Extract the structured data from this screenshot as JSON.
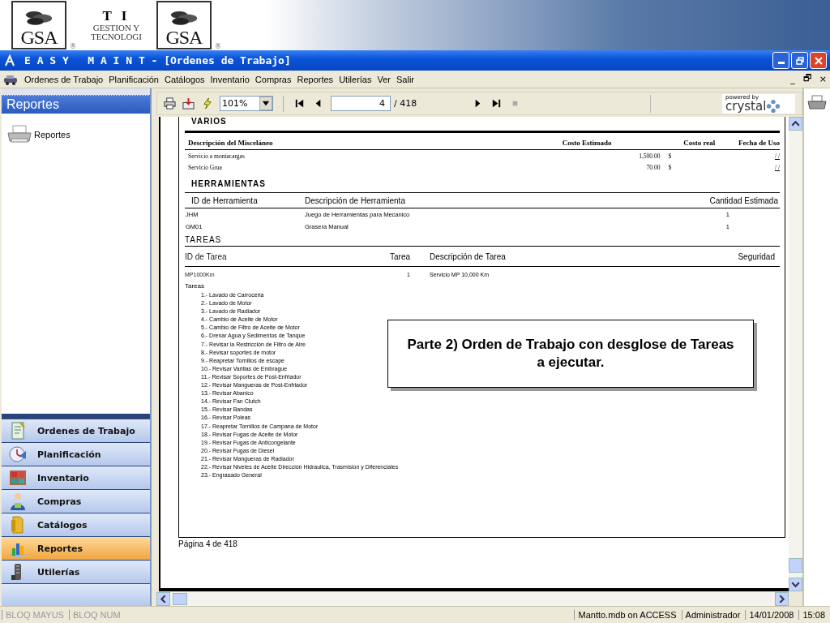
{
  "banner": {
    "logos": [
      {
        "text": "GSA",
        "mark": "®"
      },
      {
        "text": "GSA",
        "mark": "®"
      }
    ],
    "ti": "T I",
    "ti_lines": [
      "GESTION Y",
      "TECNOLOGI"
    ]
  },
  "window": {
    "title": "E A S Y   M A I N T - [Ordenes de Trabajo]"
  },
  "menu": {
    "items": [
      "Ordenes de Trabajo",
      "Planificación",
      "Catálogos",
      "Inventario",
      "Compras",
      "Reportes",
      "Utilerías",
      "Ver",
      "Salir"
    ],
    "mdi_controls": [
      "_",
      "🗗",
      "×"
    ]
  },
  "sidebar": {
    "title": "Reportes",
    "items": [
      {
        "label": "Reportes"
      }
    ],
    "nav": [
      {
        "label": "Ordenes de Trabajo",
        "kind": "document",
        "selected": false
      },
      {
        "label": "Planificación",
        "kind": "clock",
        "selected": false
      },
      {
        "label": "Inventario",
        "kind": "shelf",
        "selected": false
      },
      {
        "label": "Compras",
        "kind": "person",
        "selected": false
      },
      {
        "label": "Catálogos",
        "kind": "folder",
        "selected": false
      },
      {
        "label": "Reportes",
        "kind": "chart",
        "selected": true
      },
      {
        "label": "Utilerías",
        "kind": "tool",
        "selected": false
      }
    ]
  },
  "viewer": {
    "zoom": "101%",
    "page": "4",
    "page_total": "/ 418",
    "brand_small": "powered by",
    "brand": "crystal"
  },
  "report": {
    "varios": {
      "title": "VARIOS",
      "columns": [
        "Descripción del Misceláneo",
        "Costo Estimado",
        "Costo real",
        "Fecha de Uso"
      ],
      "rows": [
        {
          "description": "Servicio a montacargas",
          "cost": "1,500.00",
          "currency": "$",
          "date": "/   /"
        },
        {
          "description": "Servicio Grua",
          "cost": "70.00",
          "currency": "$",
          "date": "/   /"
        }
      ]
    },
    "herramientas": {
      "title": "HERRAMIENTAS",
      "columns": [
        "ID de Herramienta",
        "Descripción de Herramienta",
        "Cantidad Estimada"
      ],
      "rows": [
        {
          "id": "JHM",
          "description": "Juego de Herramientas para Mecanico",
          "qty": "1"
        },
        {
          "id": "GM01",
          "description": "Grasera Manual",
          "qty": "1"
        }
      ]
    },
    "tareas": {
      "title": "TAREAS",
      "columns": [
        "ID de Tarea",
        "Tarea",
        "Descripción de Tarea",
        "Seguridad"
      ],
      "rows": [
        {
          "id": "MP1000Km",
          "task": "1",
          "description": "Servicio MP 10,000 Km"
        }
      ]
    },
    "tasks_label": "Tareas",
    "tasks": [
      "1.- Lavado de Carroceria",
      "2.- Lavado de Motor",
      "3.- Lavado de Radiador",
      "4.- Cambio de Aceite de Motor",
      "5.- Cambio de Filtro de Aceite de Motor",
      "6.- Drenar Agua y Sedimentos de Tanque",
      "7.- Revisar la Restricción de Filtro de Aire",
      "8.- Revisar soportes de motor",
      "9.- Reapretar Tornillos de escape",
      "10.- Revisar Varillas de Embrague",
      "11.- Revisar Soportes de Post-Enfriador",
      "12.- Revisar Mangueras de Post-Enfriador",
      "13.- Revisar Abanico",
      "14.- Revisar Fan Clutch",
      "15.- Revisar Bandas",
      "16.- Revisar Poleas",
      "17.- Reapretar Tornillos de Campana de Motor",
      "18.- Revisar Fugas de Aceite de Motor",
      "19.- Revisar Fugas de Anticongelante",
      "20.- Revisar Fugas de Diesel",
      "21.- Revisar Mangueras de Radiador",
      "22.- Revisar Niveles de Aceite Dirección Hidraulica, Trasmision y Diferenciales",
      "23.- Engrasado General"
    ],
    "footer": "Página 4 de 418"
  },
  "callout": "Parte 2) Orden de Trabajo con desglose de Tareas a ejecutar.",
  "status_bar": {
    "left": [
      "BLOQ MAYUS",
      "BLOQ NUM"
    ],
    "right": [
      "Mantto.mdb on ACCESS",
      "Administrador",
      "14/01/2008",
      "15:08"
    ]
  }
}
